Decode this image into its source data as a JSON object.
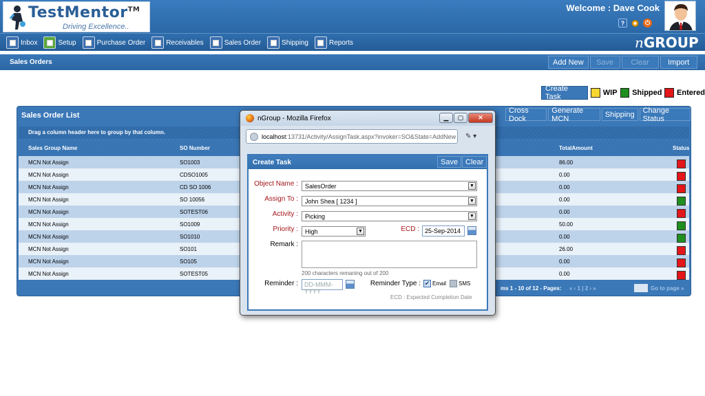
{
  "app": {
    "logo_main": "TestMentor",
    "logo_tm": "TM",
    "logo_tagline": "Driving Excellence..",
    "welcome": "Welcome : Dave Cook",
    "brand_prefix": "n",
    "brand": "GROUP"
  },
  "nav": [
    {
      "label": "Inbox",
      "icon": "inbox-icon",
      "color": "#3b6fb0"
    },
    {
      "label": "Setup",
      "icon": "setup-gear-icon",
      "color": "#5aa83a"
    },
    {
      "label": "Purchase Order",
      "icon": "document-icon",
      "color": "#3b6fb0"
    },
    {
      "label": "Receivables",
      "icon": "document-icon",
      "color": "#3b6fb0"
    },
    {
      "label": "Sales Order",
      "icon": "document-icon",
      "color": "#3b6fb0"
    },
    {
      "label": "Shipping",
      "icon": "document-icon",
      "color": "#3b6fb0"
    },
    {
      "label": "Reports",
      "icon": "bar-chart-icon",
      "color": "#3b6fb0"
    }
  ],
  "page": {
    "title": "Sales Orders",
    "buttons": {
      "add_new": "Add New",
      "save": "Save",
      "clear": "Clear",
      "import": "Import"
    }
  },
  "legend": {
    "create_task": "Create Task",
    "items": [
      {
        "label": "WIP",
        "color": "#f7d631"
      },
      {
        "label": "Shipped",
        "color": "#1f8f1f"
      },
      {
        "label": "Entered",
        "color": "#e3161a"
      }
    ]
  },
  "grid": {
    "title": "Sales Order List",
    "buttons": [
      "Cross Dock",
      "Generate MCN",
      "Shipping",
      "Change Status"
    ],
    "group_hint": "Drag a column header here to group by that column.",
    "columns": {
      "group": "Sales Group Name",
      "so": "SO Number",
      "total": "TotalAmount",
      "status": "Status"
    },
    "rows": [
      {
        "group": "MCN Not Assign",
        "so": "SO1003",
        "total": "86.00",
        "status": "#e3161a"
      },
      {
        "group": "MCN Not Assign",
        "so": "CDSO1005",
        "total": "0.00",
        "status": "#e3161a"
      },
      {
        "group": "MCN Not Assign",
        "so": "CD SO 1006",
        "total": "0.00",
        "status": "#e3161a"
      },
      {
        "group": "MCN Not Assign",
        "so": "SO 10056",
        "total": "0.00",
        "status": "#1f8f1f"
      },
      {
        "group": "MCN Not Assign",
        "so": "SOTEST06",
        "total": "0.00",
        "status": "#e3161a"
      },
      {
        "group": "MCN Not Assign",
        "so": "SO1009",
        "total": "50.00",
        "status": "#1f8f1f"
      },
      {
        "group": "MCN Not Assign",
        "so": "SO1010",
        "total": "0.00",
        "status": "#1f8f1f"
      },
      {
        "group": "MCN Not Assign",
        "so": "SO101",
        "total": "26.00",
        "status": "#e3161a"
      },
      {
        "group": "MCN Not Assign",
        "so": "SO105",
        "total": "0.00",
        "status": "#e3161a"
      },
      {
        "group": "MCN Not Assign",
        "so": "SOTEST05",
        "total": "0.00",
        "status": "#e3161a"
      }
    ],
    "pager": {
      "text": "ms 1 - 10 of 12 - Pages:",
      "links": "« ‹ 1 | 2 › »",
      "goto": "Go to page »"
    }
  },
  "popup": {
    "window_title": "nGroup - Mozilla Firefox",
    "url_host": "localhost",
    "url_rest": ":13731/Activity/AssignTask.aspx?invoker=SO&State=AddNew",
    "title": "Create Task",
    "save": "Save",
    "clear": "Clear",
    "fields": {
      "object_name_label": "Object Name :",
      "object_name_value": "SalesOrder",
      "assign_to_label": "Assign To :",
      "assign_to_value": "John Shea [ 1234 ]",
      "activity_label": "Activity :",
      "activity_value": "Picking",
      "priority_label": "Priority :",
      "priority_value": "High",
      "ecd_label": "ECD :",
      "ecd_value": "25-Sep-2014",
      "remark_label": "Remark :",
      "remark_hint": "200 characters remaning out of 200",
      "reminder_label": "Reminder :",
      "reminder_placeholder": "DD-MMM-YYYY",
      "reminder_type_label": "Reminder Type :",
      "email_label": "Email",
      "sms_label": "SMS",
      "ecd_note": "ECD : Expected Completion Date"
    }
  }
}
